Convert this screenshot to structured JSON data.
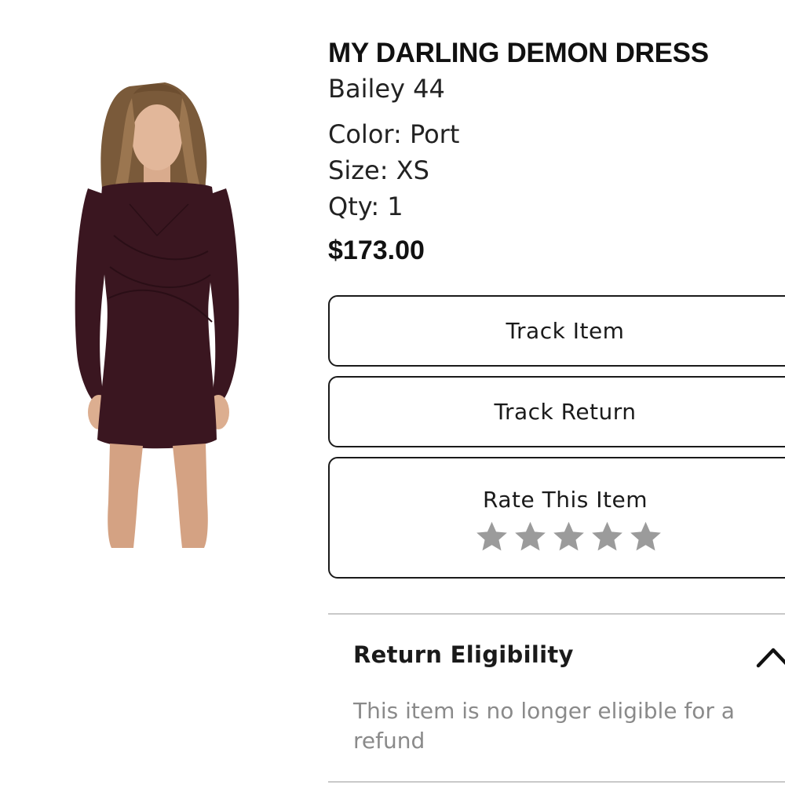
{
  "product": {
    "title": "MY DARLING DEMON DRESS",
    "brand": "Bailey 44",
    "color": "Color: Port",
    "size": "Size: XS",
    "qty": "Qty: 1",
    "price": "$173.00",
    "image": {
      "subject": "model-wearing-dress",
      "dress_color": "#3a1620",
      "hair_color": "#8a6a48",
      "skin_color": "#e2b79a"
    }
  },
  "actions": {
    "track_item": "Track Item",
    "track_return": "Track Return",
    "rate_label": "Rate This Item",
    "rating": {
      "value": 0,
      "max": 5,
      "star_color": "#9b9b9b"
    }
  },
  "return_eligibility": {
    "heading": "Return Eligibility",
    "message": "This item is no longer eligible for a refund",
    "expanded_icon": "chevron-up-icon"
  }
}
